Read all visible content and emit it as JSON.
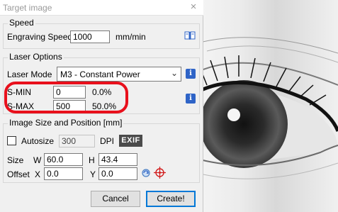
{
  "window": {
    "title": "Target image",
    "close_glyph": "×"
  },
  "speed": {
    "group_label": "Speed",
    "engraving_label": "Engraving Speed",
    "engraving_value": "1000",
    "unit": "mm/min"
  },
  "laser": {
    "group_label": "Laser Options",
    "mode_label": "Laser Mode",
    "mode_value": "M3 - Constant Power",
    "smin_label": "S-MIN",
    "smin_value": "0",
    "smin_percent": "0.0%",
    "smax_label": "S-MAX",
    "smax_value": "500",
    "smax_percent": "50.0%"
  },
  "image": {
    "group_label": "Image Size and Position [mm]",
    "autosize_label": "Autosize",
    "dpi_value": "300",
    "dpi_label": "DPI",
    "exif_label": "EXIF",
    "size_label": "Size",
    "w_label": "W",
    "w_value": "60.0",
    "h_label": "H",
    "h_value": "43.4",
    "offset_label": "Offset",
    "x_label": "X",
    "x_value": "0.0",
    "y_label": "Y",
    "y_value": "0.0"
  },
  "buttons": {
    "cancel": "Cancel",
    "create": "Create!"
  },
  "icons": {
    "info": "i",
    "colors": {
      "info": "#2f64c7",
      "highlight": "#e8101c",
      "default_button_border": "#0078d7"
    }
  }
}
